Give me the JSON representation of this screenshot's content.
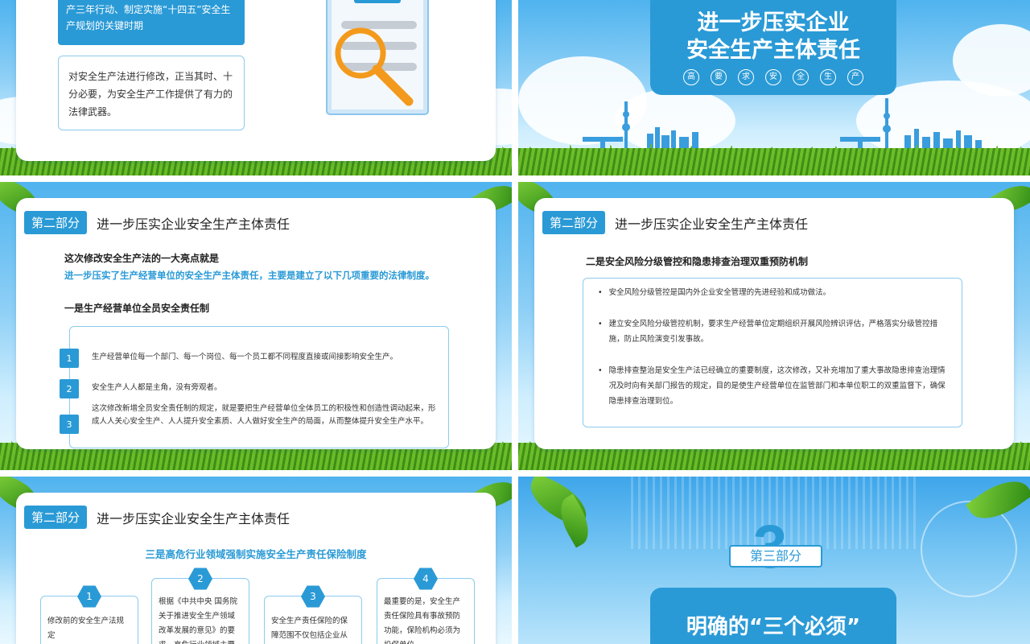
{
  "slide1": {
    "blue_box_text": "产三年行动、制定实施“十四五”安全生产规划的关键时期",
    "outline_box_text": "对安全生产法进行修改，正当其时、十分必要，为安全生产工作提供了有力的法律武器。"
  },
  "slide2": {
    "title_line1": "进一步压实企业",
    "title_line2": "安全生产主体责任",
    "chars": [
      "高",
      "要",
      "求",
      "安",
      "全",
      "生",
      "产"
    ]
  },
  "slide3": {
    "badge": "第二部分",
    "section_title": "进一步压实企业安全生产主体责任",
    "intro": "这次修改安全生产法的一大亮点就是",
    "highlight": "进一步压实了生产经营单位的安全生产主体责任，主要是建立了以下几项重要的法律制度。",
    "subheading": "一是生产经营单位全员安全责任制",
    "items": [
      {
        "num": "1",
        "text": "生产经营单位每一个部门、每一个岗位、每一个员工都不同程度直接或间接影响安全生产。"
      },
      {
        "num": "2",
        "text": "安全生产人人都是主角，没有旁观者。"
      },
      {
        "num": "3",
        "text": "这次修改新增全员安全责任制的规定，就是要把生产经营单位全体员工的积极性和创造性调动起来，形成人人关心安全生产、人人提升安全素质、人人做好安全生产的局面，从而整体提升安全生产水平。"
      }
    ]
  },
  "slide4": {
    "badge": "第二部分",
    "section_title": "进一步压实企业安全生产主体责任",
    "heading": "二是安全风险分级管控和隐患排查治理双重预防机制",
    "bullets": [
      "安全风险分级管控是国内外企业安全管理的先进经验和成功做法。",
      "建立安全风险分级管控机制，要求生产经营单位定期组织开展风险辨识评估，严格落实分级管控措施，防止风险演变引发事故。",
      "隐患排查整治是安全生产法已经确立的重要制度，这次修改，又补充增加了重大事故隐患排查治理情况及时向有关部门报告的规定，目的是使生产经营单位在监管部门和本单位职工的双重监督下，确保隐患排查治理到位。"
    ]
  },
  "slide5": {
    "badge": "第二部分",
    "section_title": "进一步压实企业安全生产主体责任",
    "heading": "三是高危行业领域强制实施安全生产责任保险制度",
    "cards": [
      {
        "num": "1",
        "text": "修改前的安全生产法规定"
      },
      {
        "num": "2",
        "text": "根据《中共中央 国务院关于推进安全生产领域改革发展的意见》的要求，高危行业领域主要是矿山"
      },
      {
        "num": "3",
        "text": "安全生产责任保险的保障范围不仅包括企业从业人"
      },
      {
        "num": "4",
        "text": "最重要的是，安全生产责任保险具有事故预防功能，保险机构必须为投保单位"
      }
    ]
  },
  "slide6": {
    "big_number": "3",
    "part_label": "第三部分",
    "title": "明确的“三个必须”"
  }
}
